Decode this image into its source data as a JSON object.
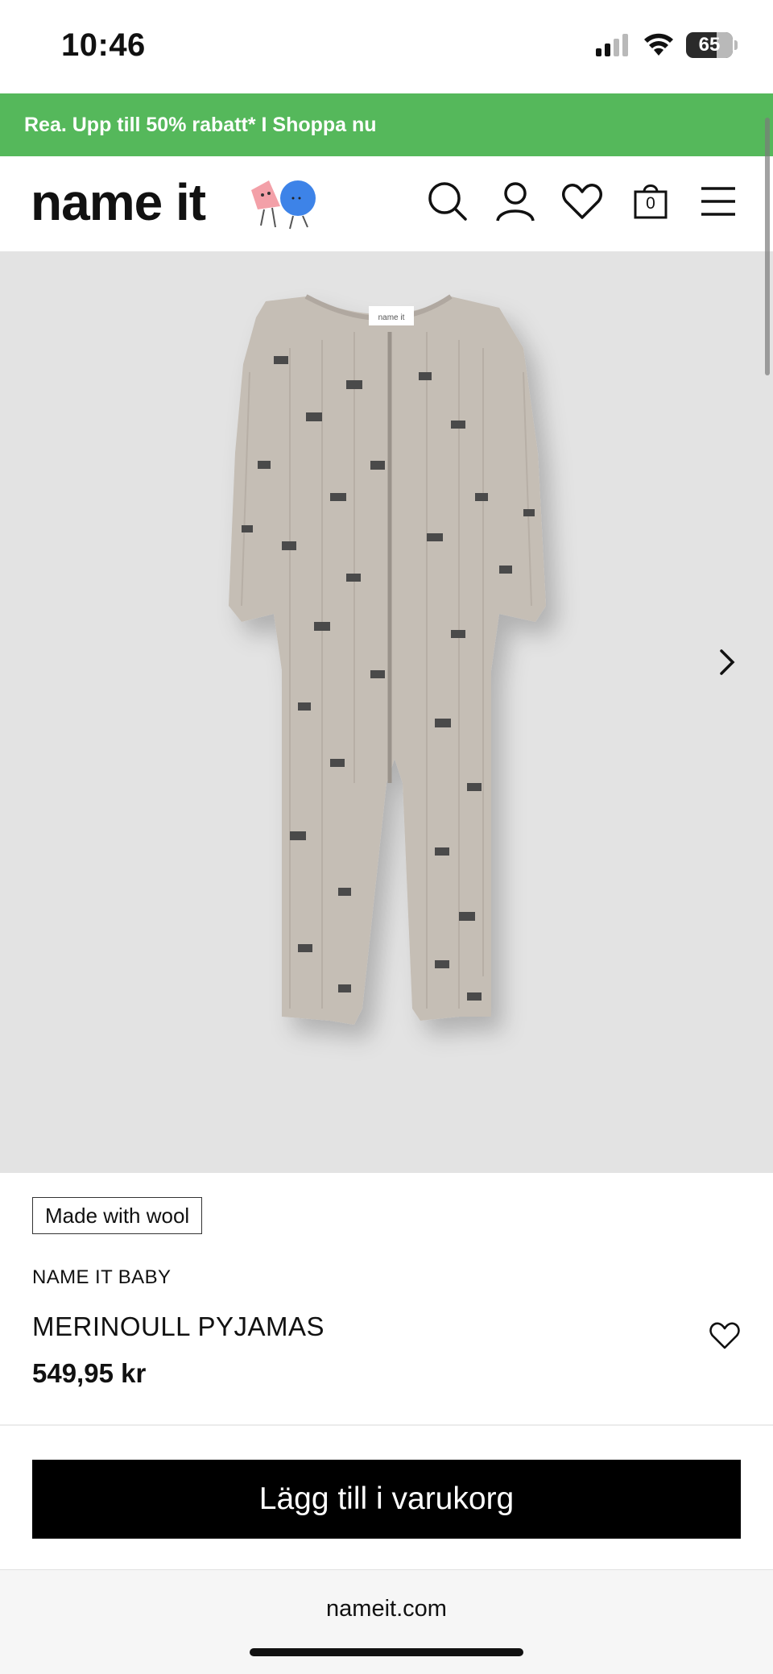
{
  "status_bar": {
    "time": "10:46",
    "battery": "65",
    "icons": [
      "signal-icon",
      "wifi-icon",
      "battery-icon"
    ]
  },
  "promo": {
    "text": "Rea. Upp till 50% rabatt* I Shoppa nu",
    "color": "#55b85b"
  },
  "header": {
    "logo": "name it",
    "icons": [
      "search-icon",
      "account-icon",
      "wishlist-icon",
      "cart-icon",
      "menu-icon"
    ],
    "cart_count": "0"
  },
  "product": {
    "badge": "Made with wool",
    "brand": "NAME IT BABY",
    "name": "MERINOULL PYJAMAS",
    "price": "549,95 kr",
    "image_label": "name it"
  },
  "cta": {
    "add_to_cart": "Lägg till i varukorg"
  },
  "browser": {
    "url": "nameit.com"
  }
}
